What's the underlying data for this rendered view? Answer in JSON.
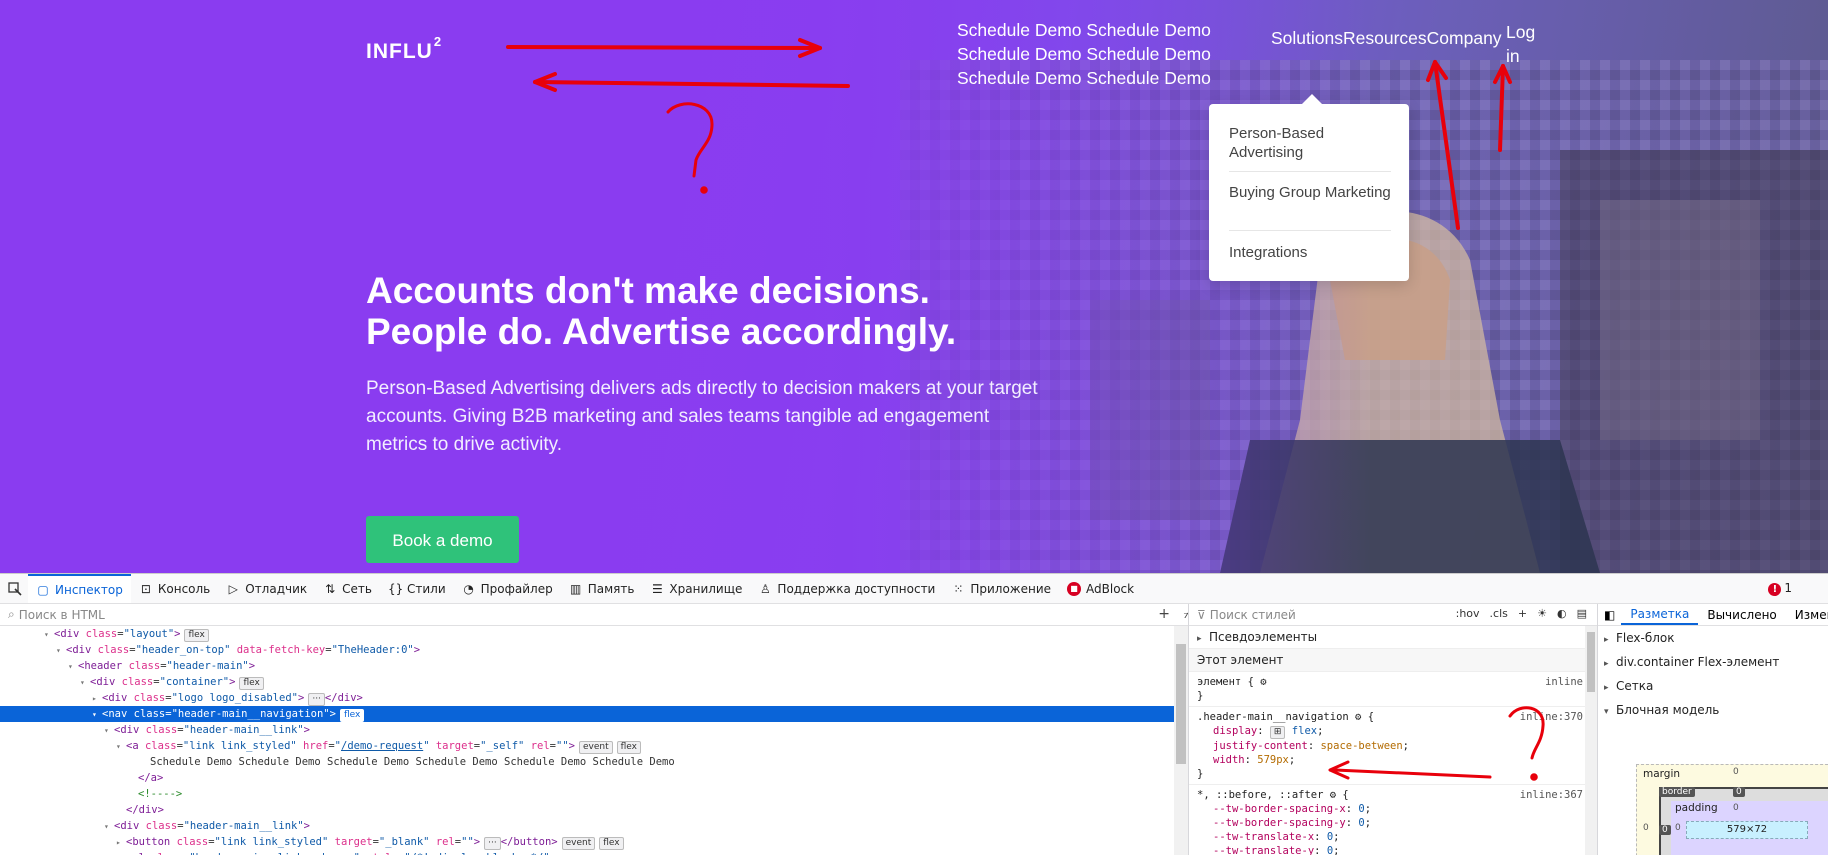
{
  "site": {
    "logo": "INFLU",
    "logo_sup": "2",
    "schedule_demo_link": "Schedule Demo Schedule Demo Schedule Demo Schedule Demo Schedule Demo Schedule Demo",
    "nav": [
      "Solutions",
      "Resources",
      "Company"
    ],
    "login": "Log in",
    "dropdown": [
      "Person-Based Advertising",
      "Buying Group Marketing",
      "Integrations"
    ],
    "hero_title_line1": "Accounts don't make decisions.",
    "hero_title_line2": "People do. Advertise accordingly.",
    "hero_subtitle": "Person-Based Advertising delivers ads directly to decision makers at your target accounts. Giving B2B marketing and sales teams tangible ad engagement metrics to drive activity.",
    "cta": "Book a demo",
    "cta_color": "#2fc27a",
    "bg_gradient_start": "#7d2fe6"
  },
  "annotations": {
    "question_mark": "?",
    "color": "#e8000b"
  },
  "devtools": {
    "tabs": [
      "Инспектор",
      "Консоль",
      "Отладчик",
      "Сеть",
      "Стили",
      "Профайлер",
      "Память",
      "Хранилище",
      "Поддержка доступности",
      "Приложение",
      "AdBlock"
    ],
    "tab_icons": [
      "inspector-icon",
      "console-icon",
      "debugger-icon",
      "network-icon",
      "style-editor-icon",
      "performance-icon",
      "memory-icon",
      "storage-icon",
      "accessibility-icon",
      "application-icon",
      "adblock-icon"
    ],
    "error_count": "1",
    "html_search_placeholder": "Поиск в HTML",
    "tree": [
      {
        "indent": 3,
        "tw": "▾",
        "html": "<span class='tg'>&lt;div</span> <span class='at'>class</span>=<span class='av'>\"layout\"</span><span class='tg'>&gt;</span>",
        "badge": "flex"
      },
      {
        "indent": 4,
        "tw": "▾",
        "html": "<span class='tg'>&lt;div</span> <span class='at'>class</span>=<span class='av'>\"header_on-top\"</span> <span class='at'>data-fetch-key</span>=<span class='av'>\"TheHeader:0\"</span><span class='tg'>&gt;</span>",
        "badge": ""
      },
      {
        "indent": 5,
        "tw": "▾",
        "html": "<span class='tg'>&lt;header</span> <span class='at'>class</span>=<span class='av'>\"header-main\"</span><span class='tg'>&gt;</span>",
        "badge": ""
      },
      {
        "indent": 6,
        "tw": "▾",
        "html": "<span class='tg'>&lt;div</span> <span class='at'>class</span>=<span class='av'>\"container\"</span><span class='tg'>&gt;</span>",
        "badge": "flex"
      },
      {
        "indent": 7,
        "tw": "▸",
        "html": "<span class='tg'>&lt;div</span> <span class='at'>class</span>=<span class='av'>\"logo logo_disabled\"</span><span class='tg'>&gt;</span><span class='badge'>···</span><span class='tg'>&lt;/div&gt;</span>",
        "badge": ""
      },
      {
        "indent": 7,
        "tw": "▾",
        "html": "<span class='tg'>&lt;nav</span> <span class='at'>class</span>=<span class='av'>\"header-main__navigation\"</span><span class='tg'>&gt;</span>",
        "badge": "flex",
        "sel": true
      },
      {
        "indent": 8,
        "tw": "▾",
        "html": "<span class='tg'>&lt;div</span> <span class='at'>class</span>=<span class='av'>\"header-main__link\"</span><span class='tg'>&gt;</span>",
        "badge": ""
      },
      {
        "indent": 9,
        "tw": "▾",
        "html": "<span class='tg'>&lt;a</span> <span class='at'>class</span>=<span class='av'>\"link link_styled\"</span> <span class='at'>href</span>=<span class='av'>\"<span class='link-u'>/demo-request</span>\"</span> <span class='at'>target</span>=<span class='av'>\"_self\"</span> <span class='at'>rel</span>=<span class='av'>\"\"</span><span class='tg'>&gt;</span><span class='badge'>event</span>",
        "badge": "flex"
      },
      {
        "indent": 11,
        "tw": "",
        "html": "Schedule Demo Schedule Demo Schedule Demo Schedule Demo Schedule Demo Schedule Demo",
        "badge": ""
      },
      {
        "indent": 10,
        "tw": "",
        "html": "<span class='tg'>&lt;/a&gt;</span>",
        "badge": ""
      },
      {
        "indent": 10,
        "tw": "",
        "html": "<span class='cm'>&lt;!----&gt;</span>",
        "badge": ""
      },
      {
        "indent": 9,
        "tw": "",
        "html": "<span class='tg'>&lt;/div&gt;</span>",
        "badge": ""
      },
      {
        "indent": 8,
        "tw": "▾",
        "html": "<span class='tg'>&lt;div</span> <span class='at'>class</span>=<span class='av'>\"header-main__link\"</span><span class='tg'>&gt;</span>",
        "badge": ""
      },
      {
        "indent": 9,
        "tw": "▸",
        "html": "<span class='tg'>&lt;button</span> <span class='at'>class</span>=<span class='av'>\"link link_styled\"</span> <span class='at'>target</span>=<span class='av'>\"_blank\"</span> <span class='at'>rel</span>=<span class='av'>\"\"</span><span class='tg'>&gt;</span><span class='badge'>···</span><span class='tg'>&lt;/button&gt;</span><span class='badge'>event</span>",
        "badge": "flex"
      },
      {
        "indent": 9,
        "tw": "▾",
        "html": "<span class='tg'>&lt;ul</span> <span class='at'>class</span>=<span class='av'>\"header-main__link-submenu\"</span> <span class='at'>style</span>=<span class='av'>\"/*! display:block; */\"</span><span class='tg'>&gt;</span>",
        "badge": ""
      }
    ],
    "styles_search_placeholder": "Поиск стилей",
    "styles_tools": [
      ":hov",
      ".cls"
    ],
    "pseudo_elements": "Псевдоэлементы",
    "this_element": "Этот элемент",
    "element_rule": "элемент {",
    "element_src": "inline",
    "rule_selector": ".header-main__navigation",
    "rule_src": "inline:370",
    "rule_props": [
      {
        "prop": "display",
        "value": "flex"
      },
      {
        "prop": "justify-content",
        "value": "space-between"
      },
      {
        "prop": "width",
        "value": "579px"
      }
    ],
    "universal_selector": "*, ::before, ::after",
    "universal_src": "inline:367",
    "universal_props": [
      {
        "prop": "--tw-border-spacing-x",
        "value": "0"
      },
      {
        "prop": "--tw-border-spacing-y",
        "value": "0"
      },
      {
        "prop": "--tw-translate-x",
        "value": "0"
      },
      {
        "prop": "--tw-translate-y",
        "value": "0"
      }
    ],
    "layout_tabs": [
      "Разметка",
      "Вычислено",
      "Измен"
    ],
    "layout_sections": [
      "Flex-блок",
      "div.container Flex-элемент",
      "Сетка",
      "Блочная модель"
    ],
    "box_model": {
      "margin_label": "margin",
      "border_label": "border",
      "padding_label": "padding",
      "content_size": "579×72",
      "zero": "0"
    }
  }
}
